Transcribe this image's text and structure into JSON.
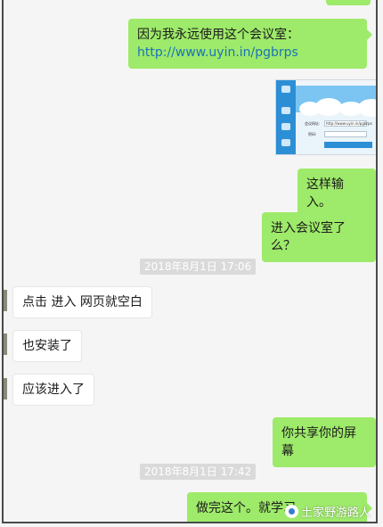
{
  "messages": [
    {
      "side": "sent",
      "text": "因为我永远使用这个会议室：",
      "link": "http://www.uyin.in/pgbrps"
    },
    {
      "side": "sent",
      "type": "image",
      "image": {
        "sidebar_icons": [
          "logo-icon",
          "meeting-icon",
          "record-icon",
          "user-icon"
        ],
        "label_room": "会议网址:",
        "label_pwd": "密码:",
        "field_value": "http://www.uyin.in/pgbrps"
      }
    },
    {
      "side": "sent",
      "text": "这样输入。"
    },
    {
      "side": "sent",
      "text": "进入会议室了么？"
    },
    {
      "type": "time",
      "text": "2018年8月1日 17:06"
    },
    {
      "side": "received",
      "text": "点击 进入 网页就空白"
    },
    {
      "side": "received",
      "text": "也安装了"
    },
    {
      "side": "received",
      "text": "应该进入了"
    },
    {
      "side": "sent",
      "text": "你共享你的屏幕"
    },
    {
      "type": "time",
      "text": "2018年8月1日 17:42"
    },
    {
      "side": "sent",
      "text": "做完这个。就学习"
    }
  ],
  "watermark": {
    "text": "土家野游路人",
    "icon": "wechat-account-icon"
  },
  "colors": {
    "sent_bubble": "#9eea6a",
    "received_bubble": "#ffffff",
    "link": "#1a73b8",
    "background": "#f5f5f5"
  }
}
